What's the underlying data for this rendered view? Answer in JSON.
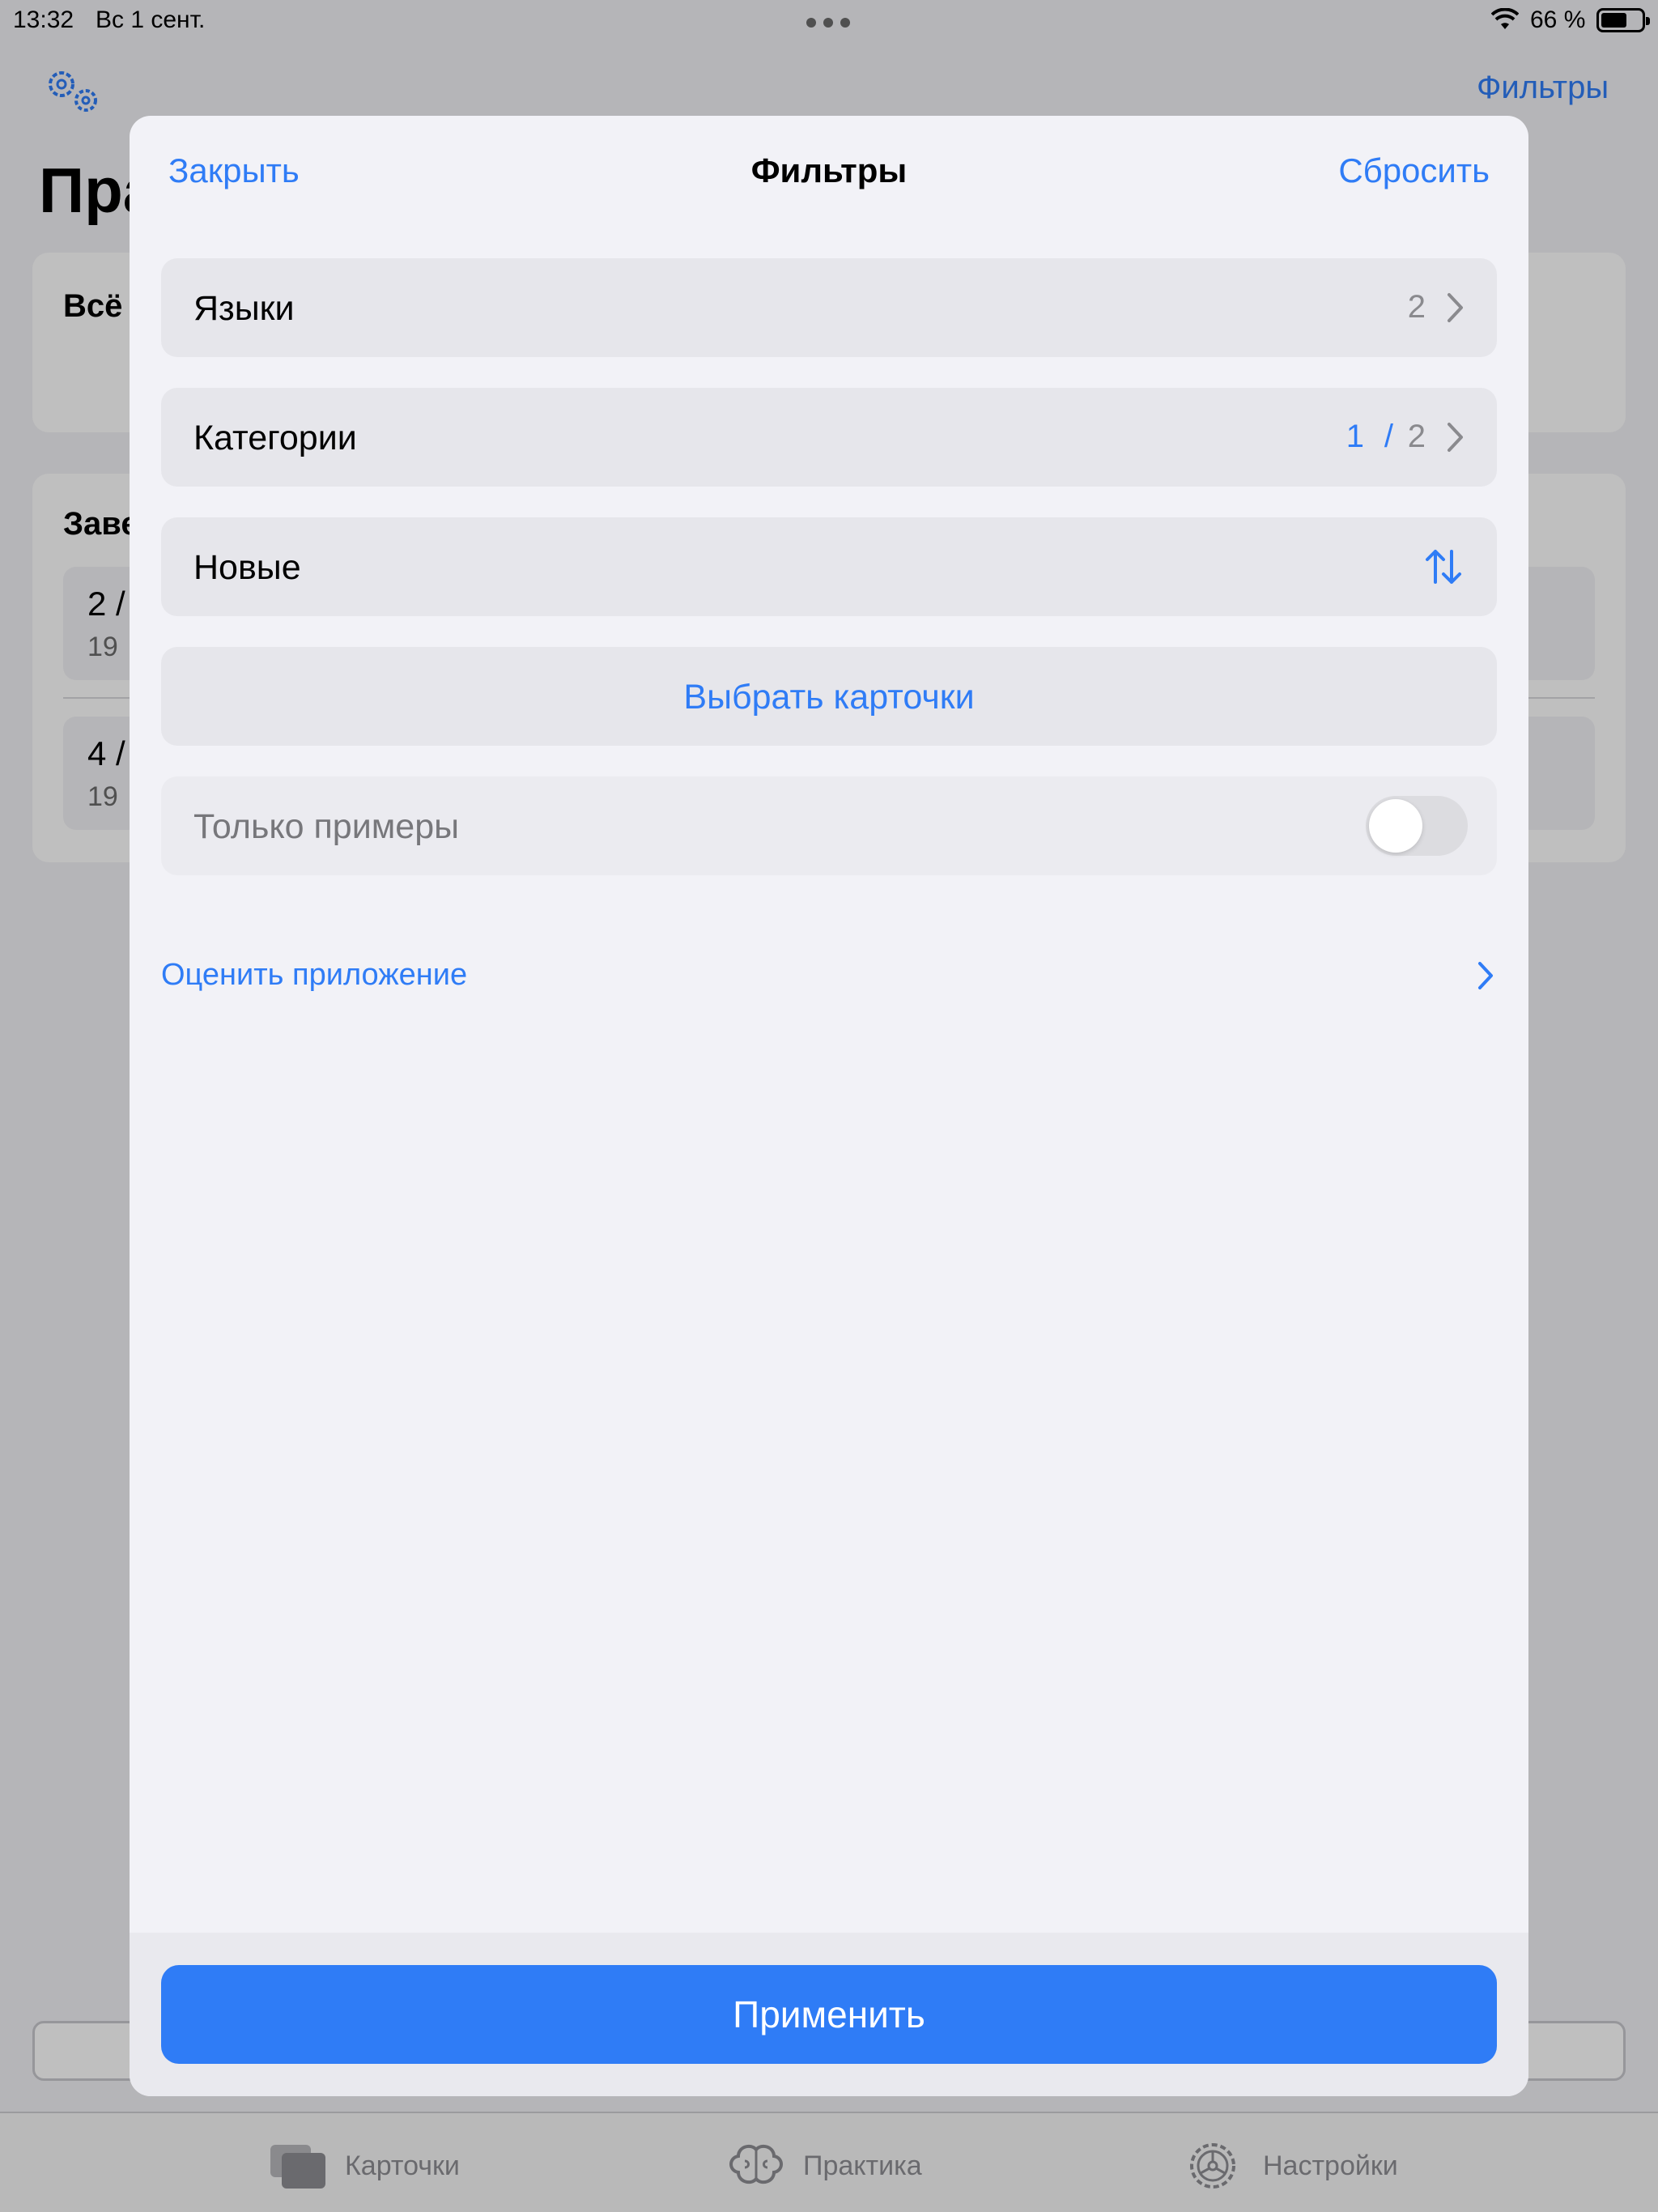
{
  "status_bar": {
    "time": "13:32",
    "date": "Вс 1 сент.",
    "battery_percent": "66 %",
    "battery_level": 0.66
  },
  "background": {
    "filters_link": "Фильтры",
    "title": "Пра",
    "card1_title": "Всё",
    "card2_title": "Заве",
    "rows": [
      {
        "a": "2 /",
        "b": "19"
      },
      {
        "a": "4 /",
        "b": "19"
      }
    ]
  },
  "tabbar": {
    "items": [
      {
        "label": "Карточки",
        "icon": "cards-icon"
      },
      {
        "label": "Практика",
        "icon": "brain-icon"
      },
      {
        "label": "Настройки",
        "icon": "settings-gear-icon"
      }
    ]
  },
  "modal": {
    "close_label": "Закрыть",
    "title": "Фильтры",
    "reset_label": "Сбросить",
    "languages": {
      "label": "Языки",
      "count": "2"
    },
    "categories": {
      "label": "Категории",
      "selected": "1",
      "separator": "/",
      "total": "2"
    },
    "sort": {
      "label": "Новые",
      "icon": "sort-arrows-icon"
    },
    "select_cards_label": "Выбрать карточки",
    "examples_only": {
      "label": "Только примеры",
      "enabled": false
    },
    "rate_app_label": "Оценить приложение",
    "apply_label": "Применить"
  },
  "colors": {
    "accent": "#2f7cf6",
    "row_bg": "#e6e6eb",
    "sheet_bg": "#f2f2f7"
  }
}
